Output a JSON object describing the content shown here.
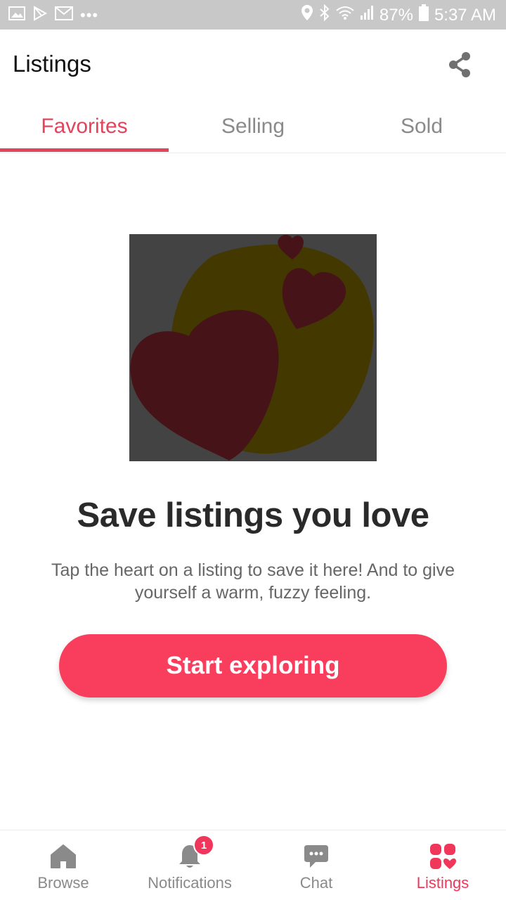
{
  "status_bar": {
    "battery": "87%",
    "time": "5:37 AM",
    "left_icons": [
      "gallery-icon",
      "play-store-icon",
      "gmail-icon",
      "more-dots-icon"
    ],
    "right_icons": [
      "location-icon",
      "bluetooth-icon",
      "wifi-icon",
      "signal-icon",
      "battery-icon"
    ]
  },
  "app_bar": {
    "title": "Listings",
    "share_icon": "share-icon"
  },
  "tabs": [
    {
      "label": "Favorites",
      "active": true
    },
    {
      "label": "Selling",
      "active": false
    },
    {
      "label": "Sold",
      "active": false
    }
  ],
  "empty_state": {
    "title": "Save listings you love",
    "description": "Tap the heart on a listing to save it here! And to give yourself a warm, fuzzy feeling.",
    "cta_label": "Start exploring"
  },
  "bottom_nav": [
    {
      "label": "Browse",
      "icon": "home-icon",
      "active": false
    },
    {
      "label": "Notifications",
      "icon": "bell-icon",
      "active": false,
      "badge": "1"
    },
    {
      "label": "Chat",
      "icon": "chat-icon",
      "active": false
    },
    {
      "label": "Listings",
      "icon": "listings-heart-icon",
      "active": true
    }
  ],
  "colors": {
    "accent": "#e0455b",
    "cta": "#f93d5c",
    "inactive": "#8a8a8a",
    "status_bar": "#c8c8c8"
  }
}
